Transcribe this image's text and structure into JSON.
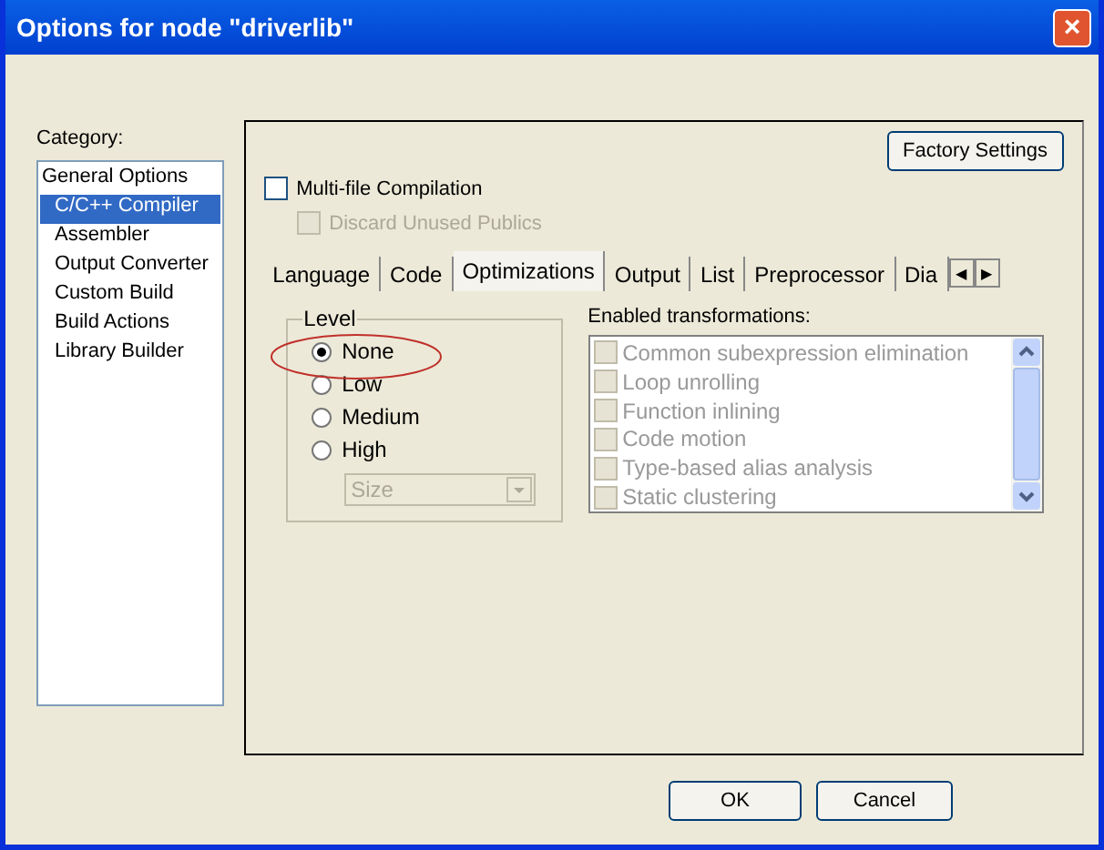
{
  "window": {
    "title": "Options for node \"driverlib\"",
    "close": "×"
  },
  "category": {
    "label": "Category:",
    "items": [
      {
        "label": "General Options",
        "selected": false,
        "child": false
      },
      {
        "label": "C/C++ Compiler",
        "selected": true,
        "child": true
      },
      {
        "label": "Assembler",
        "selected": false,
        "child": true
      },
      {
        "label": "Output Converter",
        "selected": false,
        "child": true
      },
      {
        "label": "Custom Build",
        "selected": false,
        "child": true
      },
      {
        "label": "Build Actions",
        "selected": false,
        "child": true
      },
      {
        "label": "Library Builder",
        "selected": false,
        "child": true
      }
    ]
  },
  "factory_button": "Factory Settings",
  "options": [
    {
      "label": "Multi-file Compilation",
      "checked": false,
      "disabled": false
    },
    {
      "label": "Discard Unused Publics",
      "checked": false,
      "disabled": true
    }
  ],
  "tabs": [
    {
      "label": "Language",
      "selected": false
    },
    {
      "label": "Code",
      "selected": false
    },
    {
      "label": "Optimizations",
      "selected": true
    },
    {
      "label": "Output",
      "selected": false
    },
    {
      "label": "List",
      "selected": false
    },
    {
      "label": "Preprocessor",
      "selected": false
    },
    {
      "label": "Dia",
      "selected": false
    }
  ],
  "tab_scroll": [
    "◀",
    "▶"
  ],
  "level": {
    "label": "Level",
    "options": [
      {
        "label": "None",
        "selected": true
      },
      {
        "label": "Low",
        "selected": false
      },
      {
        "label": "Medium",
        "selected": false
      },
      {
        "label": "High",
        "selected": false
      }
    ],
    "dropdown": {
      "value": "Size",
      "disabled": true
    },
    "highlighted": true
  },
  "transformations": {
    "label": "Enabled transformations:",
    "disabled": true,
    "items": [
      {
        "label": "Common subexpression elimination",
        "checked": false
      },
      {
        "label": "Loop unrolling",
        "checked": false
      },
      {
        "label": "Function inlining",
        "checked": false
      },
      {
        "label": "Code motion",
        "checked": false
      },
      {
        "label": "Type-based alias analysis",
        "checked": false
      },
      {
        "label": "Static clustering",
        "checked": false
      }
    ]
  },
  "buttons": [
    "OK",
    "Cancel"
  ]
}
